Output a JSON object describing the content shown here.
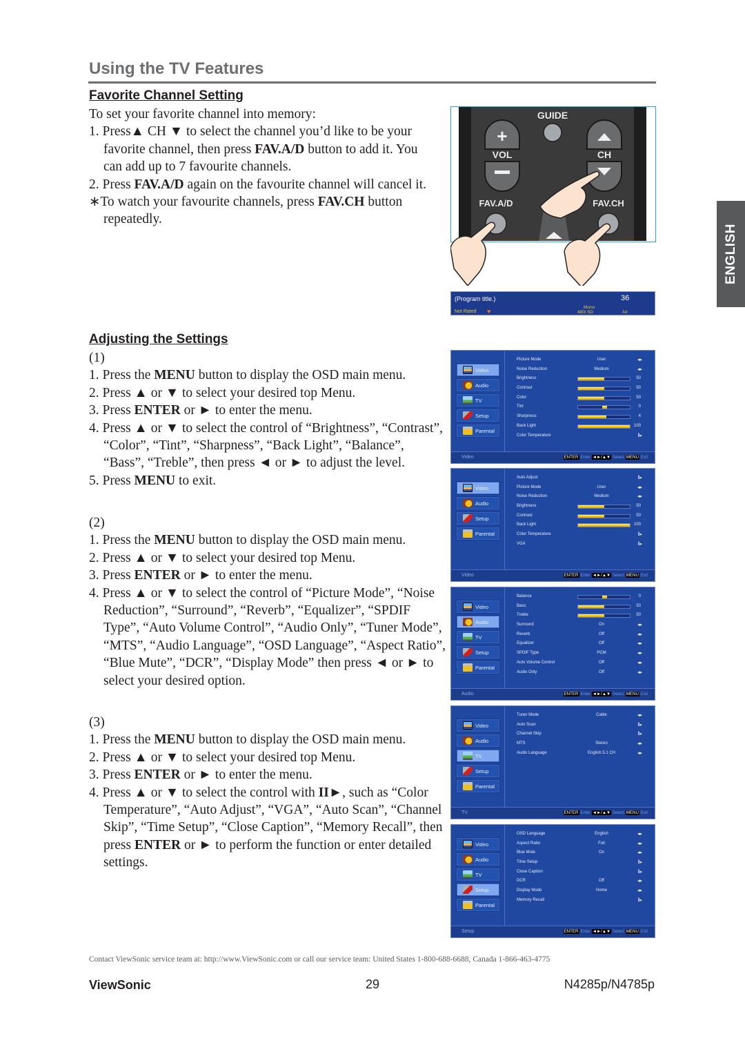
{
  "header": {
    "title": "Using the TV Features"
  },
  "language_tab": "ENGLISH",
  "favorite": {
    "heading": "Favorite Channel Setting",
    "intro": "To set your favorite channel into memory:",
    "step1_a": "1. Press▲ CH ▼ to select the channel you’d like to be your favorite channel, then press ",
    "step1_b": "FAV.A/D",
    "step1_c": " button to add it. You can add up to 7 favourite channels.",
    "step2_a": "2. Press ",
    "step2_b": "FAV.A/D",
    "step2_c": " again on the favourite channel will cancel it.",
    "note_a": "∗To watch your favourite channels, press ",
    "note_b": "FAV.CH",
    "note_c": " button repeatedly."
  },
  "remote": {
    "guide": "GUIDE",
    "vol": "VOL",
    "ch": "CH",
    "fav_ad": "FAV.A/D",
    "fav_ch": "FAV.CH",
    "plus": "+",
    "minus": "−"
  },
  "info_banner": {
    "program": "(Program title.)",
    "channel": "36",
    "rating": "Not Rated",
    "heart": "♥",
    "audio": "Mono",
    "resolution": "480i SD",
    "source": "Air"
  },
  "adjusting": {
    "heading": "Adjusting the Settings",
    "part1": {
      "label": "(1)",
      "s1_a": "1. Press the ",
      "s1_b": "MENU",
      "s1_c": " button to display the OSD main menu.",
      "s2": "2. Press ▲ or ▼ to select your desired top Menu.",
      "s3_a": "3. Press ",
      "s3_b": "ENTER",
      "s3_c": " or ► to enter the menu.",
      "s4": "4. Press ▲ or ▼ to select the control of “Brightness”, “Contrast”, “Color”, “Tint”, “Sharpness”, “Back Light”, “Balance”, “Bass”, “Treble”, then press ◄ or ► to adjust the level.",
      "s5_a": "5. Press ",
      "s5_b": "MENU",
      "s5_c": " to exit."
    },
    "part2": {
      "label": "(2)",
      "s1_a": "1. Press the ",
      "s1_b": "MENU",
      "s1_c": " button to display the OSD main menu.",
      "s2": "2. Press ▲ or ▼ to select your desired top Menu.",
      "s3_a": "3. Press ",
      "s3_b": "ENTER",
      "s3_c": " or ► to enter the menu.",
      "s4": "4. Press ▲ or ▼ to select the control of “Picture Mode”, “Noise Reduction”, “Surround”, “Reverb”, “Equalizer”, “SPDIF Type”, “Auto Volume Control”, “Audio Only”, “Tuner Mode”, “MTS”, “Audio Language”, “OSD Language”, “Aspect Ratio”, “Blue Mute”, “DCR”, “Display Mode” then press ◄ or ► to select your desired option."
    },
    "part3": {
      "label": "(3)",
      "s1_a": "1. Press the ",
      "s1_b": "MENU",
      "s1_c": " button to display the OSD main menu.",
      "s2": "2. Press ▲ or ▼ to select your desired top Menu.",
      "s3_a": "3. Press ",
      "s3_b": "ENTER",
      "s3_c": " or ► to enter the menu.",
      "s4_a": "4. Press ▲ or ▼ to select the control with ",
      "s4_b": "II►",
      "s4_c": ", such as “Color Temperature”, “Auto Adjust”, “VGA”, “Auto  Scan”, “Channel Skip”, “Time Setup”, “Close Caption”, “Memory Recall”, then press ",
      "s4_d": "ENTER",
      "s4_e": " or ► to perform the function or enter detailed settings."
    }
  },
  "osd_footer": {
    "enter_key": "ENTER",
    "enter_label": "Enter",
    "select_key": "◄►/▲▼",
    "select_label": "Select",
    "menu_key": "MENU",
    "exit_label": "Exit"
  },
  "osd_menus": [
    {
      "section": "Video",
      "nav": [
        {
          "label": "Video",
          "icon": "video",
          "active": true
        },
        {
          "label": "Audio",
          "icon": "audio",
          "active": false
        },
        {
          "label": "TV",
          "icon": "tv",
          "active": false
        },
        {
          "label": "Setup",
          "icon": "setup",
          "active": false
        },
        {
          "label": "Parental",
          "icon": "parental",
          "active": false
        }
      ],
      "rows": [
        {
          "name": "Picture Mode",
          "type": "option",
          "value": "User"
        },
        {
          "name": "Noise Reduction",
          "type": "option",
          "value": "Medium"
        },
        {
          "name": "Brightness",
          "type": "slider",
          "value": "50",
          "level": 0.5
        },
        {
          "name": "Contrast",
          "type": "slider",
          "value": "50",
          "level": 0.5
        },
        {
          "name": "Color",
          "type": "slider",
          "value": "50",
          "level": 0.5
        },
        {
          "name": "Tint",
          "type": "center",
          "value": "0",
          "level": 0.5
        },
        {
          "name": "Sharpness",
          "type": "slider",
          "value": "4",
          "level": 0.55
        },
        {
          "name": "Back Light",
          "type": "slider",
          "value": "100",
          "level": 1.0
        },
        {
          "name": "Color Temperature",
          "type": "submenu",
          "value": ""
        }
      ]
    },
    {
      "section": "Video",
      "nav": [
        {
          "label": "Video",
          "icon": "video",
          "active": true
        },
        {
          "label": "Audio",
          "icon": "audio",
          "active": false
        },
        {
          "label": "Setup",
          "icon": "setup",
          "active": false
        },
        {
          "label": "Parental",
          "icon": "parental",
          "active": false
        }
      ],
      "rows": [
        {
          "name": "Auto Adjust",
          "type": "submenu",
          "value": ""
        },
        {
          "name": "Picture Mode",
          "type": "option",
          "value": "User"
        },
        {
          "name": "Noise Reduction",
          "type": "option",
          "value": "Medium"
        },
        {
          "name": "Brightness",
          "type": "slider",
          "value": "50",
          "level": 0.5
        },
        {
          "name": "Contrast",
          "type": "slider",
          "value": "50",
          "level": 0.5
        },
        {
          "name": "Back Light",
          "type": "slider",
          "value": "100",
          "level": 1.0
        },
        {
          "name": "Color Temperature",
          "type": "submenu",
          "value": ""
        },
        {
          "name": "VGA",
          "type": "submenu",
          "value": ""
        }
      ]
    },
    {
      "section": "Audio",
      "nav": [
        {
          "label": "Video",
          "icon": "video",
          "active": false
        },
        {
          "label": "Audio",
          "icon": "audio",
          "active": true
        },
        {
          "label": "TV",
          "icon": "tv",
          "active": false
        },
        {
          "label": "Setup",
          "icon": "setup",
          "active": false
        },
        {
          "label": "Parental",
          "icon": "parental",
          "active": false
        }
      ],
      "rows": [
        {
          "name": "Balance",
          "type": "center",
          "value": "0",
          "level": 0.5
        },
        {
          "name": "Bass",
          "type": "slider",
          "value": "50",
          "level": 0.5
        },
        {
          "name": "Treble",
          "type": "slider",
          "value": "50",
          "level": 0.5
        },
        {
          "name": "Surround",
          "type": "option",
          "value": "On"
        },
        {
          "name": "Reverb",
          "type": "option",
          "value": "Off"
        },
        {
          "name": "Equalizer",
          "type": "option",
          "value": "Off"
        },
        {
          "name": "SPDIF Type",
          "type": "option",
          "value": "PCM"
        },
        {
          "name": "Auto Volume Control",
          "type": "option",
          "value": "Off"
        },
        {
          "name": "Audio Only",
          "type": "option",
          "value": "Off"
        }
      ]
    },
    {
      "section": "TV",
      "nav": [
        {
          "label": "Video",
          "icon": "video",
          "active": false
        },
        {
          "label": "Audio",
          "icon": "audio",
          "active": false
        },
        {
          "label": "TV",
          "icon": "tv",
          "active": true
        },
        {
          "label": "Setup",
          "icon": "setup",
          "active": false
        },
        {
          "label": "Parental",
          "icon": "parental",
          "active": false
        }
      ],
      "rows": [
        {
          "name": "Tuner Mode",
          "type": "option",
          "value": "Cable"
        },
        {
          "name": "Auto Scan",
          "type": "submenu",
          "value": ""
        },
        {
          "name": "Channel Skip",
          "type": "submenu",
          "value": ""
        },
        {
          "name": "MTS",
          "type": "option",
          "value": "Stereo"
        },
        {
          "name": "Audio Language",
          "type": "option",
          "value": "English 5.1 CH"
        }
      ]
    },
    {
      "section": "Setup",
      "nav": [
        {
          "label": "Video",
          "icon": "video",
          "active": false
        },
        {
          "label": "Audio",
          "icon": "audio",
          "active": false
        },
        {
          "label": "TV",
          "icon": "tv",
          "active": false
        },
        {
          "label": "Setup",
          "icon": "setup",
          "active": true
        },
        {
          "label": "Parental",
          "icon": "parental",
          "active": false
        }
      ],
      "rows": [
        {
          "name": "OSD Language",
          "type": "option",
          "value": "English"
        },
        {
          "name": "Aspect Ratio",
          "type": "option",
          "value": "Full"
        },
        {
          "name": "Blue Mute",
          "type": "option",
          "value": "On"
        },
        {
          "name": "Time Setup",
          "type": "submenu",
          "value": ""
        },
        {
          "name": "Close Caption",
          "type": "submenu",
          "value": ""
        },
        {
          "name": "DCR",
          "type": "option",
          "value": "Off"
        },
        {
          "name": "Display Mode",
          "type": "option",
          "value": "Home"
        },
        {
          "name": "Memory Recall",
          "type": "submenu",
          "value": ""
        }
      ]
    }
  ],
  "footer": {
    "contact": "Contact ViewSonic service team at: http://www.ViewSonic.com or call our service team: United States 1-800-688-6688, Canada 1-866-463-4775",
    "brand": "ViewSonic",
    "page": "29",
    "model": "N4285p/N4785p"
  },
  "colors": {
    "osd_bg": "#2048a0",
    "osd_active": "#7fa8ee",
    "slider_fill": "#f0c800",
    "heading_gray": "#6d6e71",
    "tab_gray": "#58595b",
    "remote_border": "#2aa6d6"
  }
}
